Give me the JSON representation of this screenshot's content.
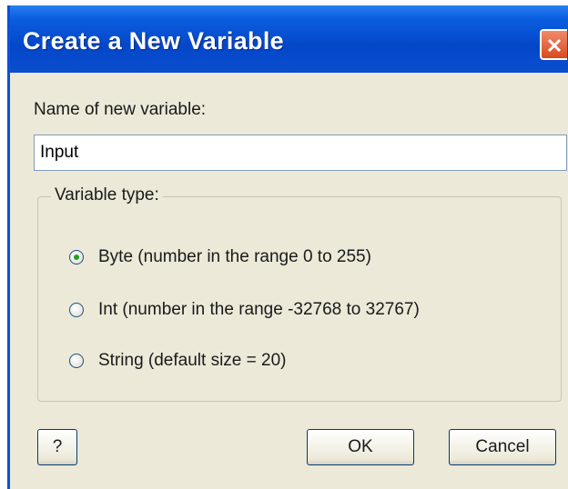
{
  "window": {
    "title": "Create a New Variable"
  },
  "form": {
    "name_label": "Name of new variable:",
    "name_value": "Input"
  },
  "variable_type": {
    "legend": "Variable type:",
    "options": [
      {
        "label": "Byte (number in the range 0 to 255)",
        "checked": true
      },
      {
        "label": "Int (number in the range -32768 to 32767)",
        "checked": false
      },
      {
        "label": "String (default size = 20)",
        "checked": false
      }
    ]
  },
  "buttons": {
    "help_label": "?",
    "ok_label": "OK",
    "cancel_label": "Cancel"
  },
  "icons": {
    "close": "close-icon"
  },
  "colors": {
    "titlebar": "#0a4ecf",
    "close_button": "#d84a22",
    "dialog_background": "#ece9d8",
    "radio_selected": "#21a121"
  }
}
